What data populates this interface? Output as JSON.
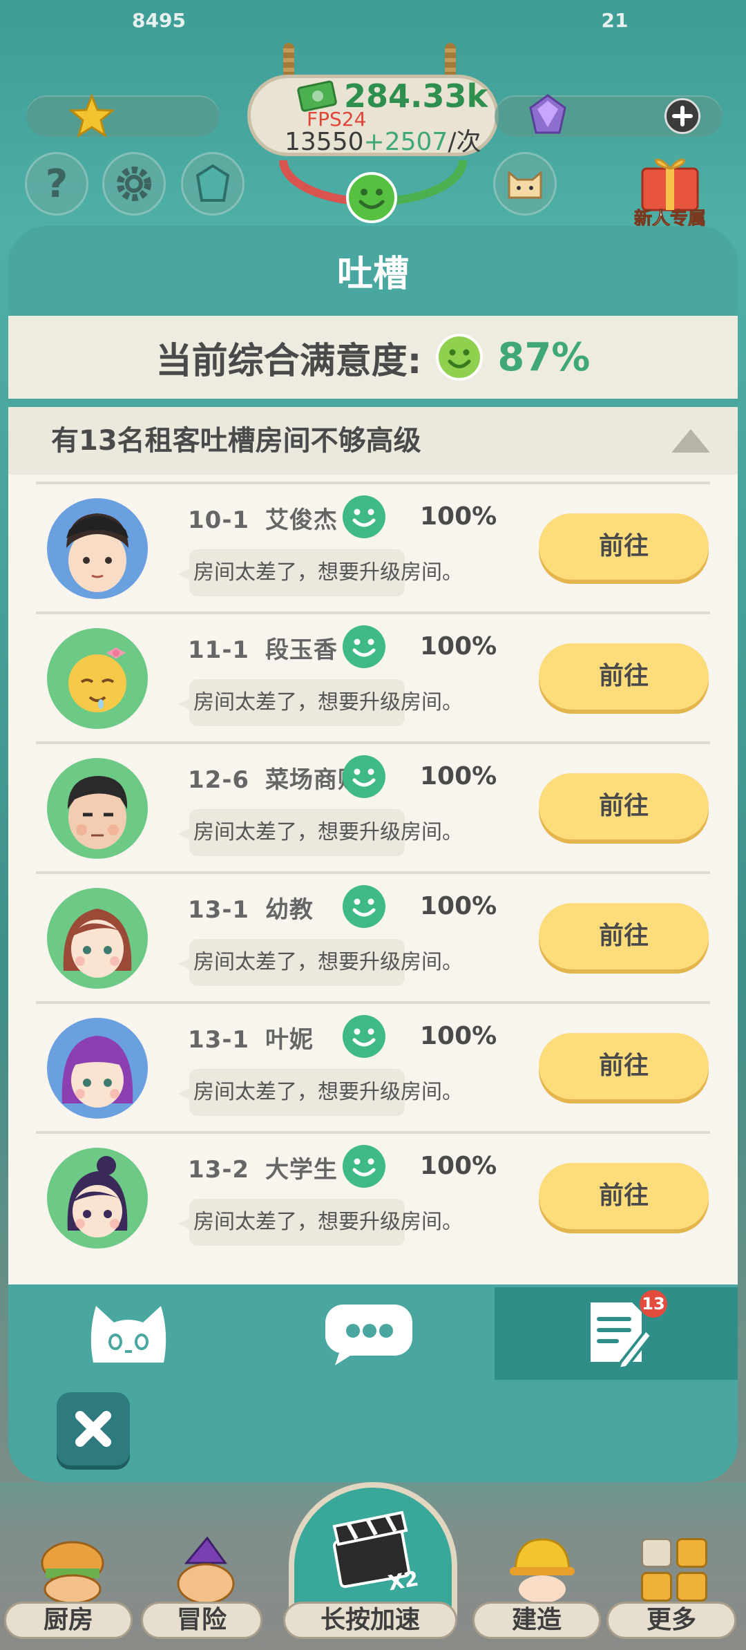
{
  "hud": {
    "stars": "8495",
    "money": "284.33k",
    "fps": "FPS24",
    "income_base": "13550",
    "income_bonus": "+2507",
    "income_unit": "/次",
    "gems": "21",
    "newbie_label": "新人专属"
  },
  "dialog": {
    "title": "吐槽",
    "satisfaction_label": "当前综合满意度:",
    "satisfaction_value": "87%",
    "section_title": "有13名租客吐槽房间不够高级",
    "go_label": "前往",
    "tenants": [
      {
        "unit": "10-1",
        "name": "艾俊杰",
        "pct": "100%",
        "complaint": "房间太差了，想要升级房间。"
      },
      {
        "unit": "11-1",
        "name": "段玉香",
        "pct": "100%",
        "complaint": "房间太差了，想要升级房间。"
      },
      {
        "unit": "12-6",
        "name": "菜场商贩",
        "pct": "100%",
        "complaint": "房间太差了，想要升级房间。"
      },
      {
        "unit": "13-1",
        "name": "幼教",
        "pct": "100%",
        "complaint": "房间太差了，想要升级房间。"
      },
      {
        "unit": "13-1",
        "name": "叶妮",
        "pct": "100%",
        "complaint": "房间太差了，想要升级房间。"
      },
      {
        "unit": "13-2",
        "name": "大学生",
        "pct": "100%",
        "complaint": "房间太差了，想要升级房间。"
      }
    ],
    "tabs_badge": "13"
  },
  "bottom_bar": {
    "kitchen": "厨房",
    "adventure": "冒险",
    "speed": "长按加速",
    "build": "建造",
    "more": "更多",
    "speed_multiplier": "X2"
  },
  "colors": {
    "teal": "#4aa7a0",
    "happy_green": "#3fa876",
    "button_yellow": "#fddc7c"
  }
}
